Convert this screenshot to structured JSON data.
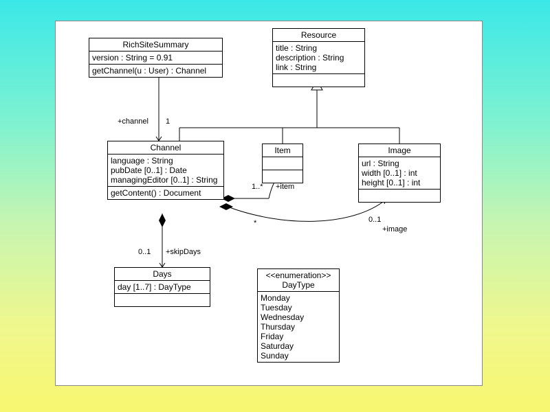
{
  "classes": {
    "richSiteSummary": {
      "name": "RichSiteSummary",
      "attrs": [
        "version : String = 0.91"
      ],
      "ops": [
        "getChannel(u : User) : Channel"
      ]
    },
    "resource": {
      "name": "Resource",
      "attrs": [
        "title : String",
        "description : String",
        "link : String"
      ]
    },
    "channel": {
      "name": "Channel",
      "attrs": [
        "language : String",
        "pubDate [0..1] : Date",
        "managingEditor [0..1] : String"
      ],
      "ops": [
        "getContent() : Document"
      ]
    },
    "item": {
      "name": "Item"
    },
    "image": {
      "name": "Image",
      "attrs": [
        "url : String",
        "width [0..1] : int",
        "height [0..1] : int"
      ]
    },
    "days": {
      "name": "Days",
      "attrs": [
        "day [1..7] : DayType"
      ]
    },
    "dayType": {
      "stereotype": "<<enumeration>>",
      "name": "DayType",
      "literals": [
        "Monday",
        "Tuesday",
        "Wednesday",
        "Thursday",
        "Friday",
        "Saturday",
        "Sunday"
      ]
    }
  },
  "labels": {
    "channelRole": "+channel",
    "channelMult": "1",
    "itemMult": "1..*",
    "itemRole": "+item",
    "imageStar": "*",
    "imageMult": "0..1",
    "imageRole": "+image",
    "skipDaysMult": "0..1",
    "skipDaysRole": "+skipDays"
  }
}
